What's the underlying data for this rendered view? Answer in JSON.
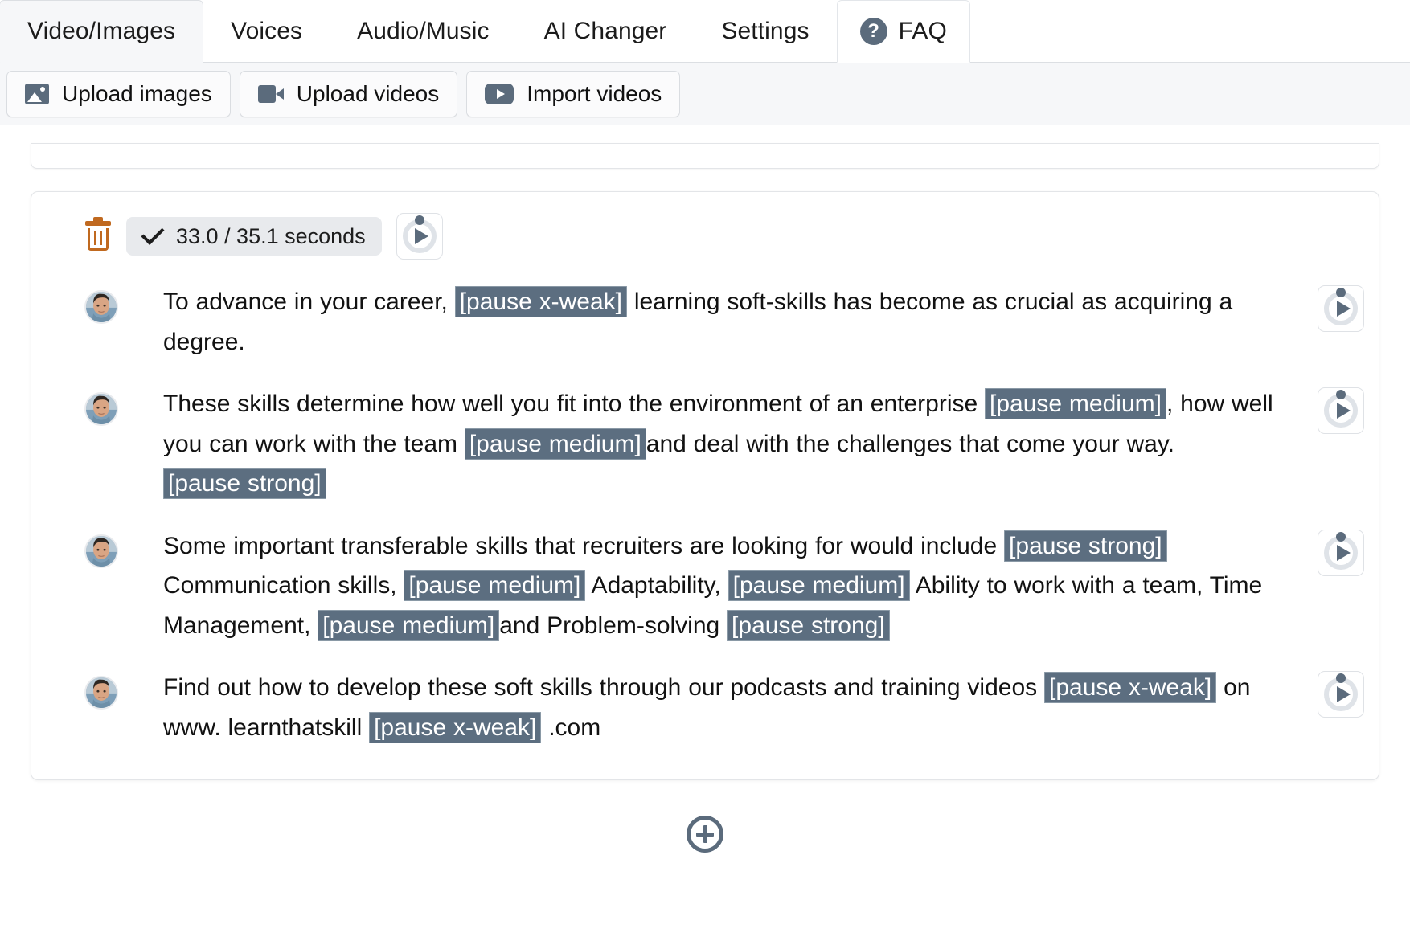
{
  "tabs": [
    {
      "label": "Video/Images",
      "active": true
    },
    {
      "label": "Voices",
      "active": false
    },
    {
      "label": "Audio/Music",
      "active": false
    },
    {
      "label": "AI Changer",
      "active": false
    },
    {
      "label": "Settings",
      "active": false
    },
    {
      "label": "FAQ",
      "active": false,
      "icon": "question-circle-icon"
    }
  ],
  "toolbar": {
    "upload_images": "Upload images",
    "upload_videos": "Upload videos",
    "import_videos": "Import videos",
    "icons": {
      "upload_images": "image-icon",
      "upload_videos": "video-camera-icon",
      "import_videos": "youtube-play-icon"
    }
  },
  "block": {
    "delete_icon": "trash-icon",
    "duration_label": "33.0 / 35.1 seconds",
    "duration_check_icon": "check-icon",
    "play_icon": "play-circle-icon",
    "current_seconds": "33.0",
    "total_seconds": "35.1"
  },
  "colors": {
    "tag_background": "#5c6e80",
    "tag_text": "#ffffff",
    "accent_slate": "#5b6b7c",
    "trash_orange": "#c0691f",
    "toolbar_background": "#f6f7f9",
    "pill_background": "#e8eaed"
  },
  "sentences": [
    {
      "avatar": "speaker-avatar",
      "play_icon": "play-circle-icon",
      "parts": [
        {
          "t": "text",
          "v": "To advance in your career, "
        },
        {
          "t": "tag",
          "v": "[pause x-weak]"
        },
        {
          "t": "text",
          "v": " learning soft-skills has become as crucial as acquiring a degree."
        }
      ]
    },
    {
      "avatar": "speaker-avatar",
      "play_icon": "play-circle-icon",
      "parts": [
        {
          "t": "text",
          "v": "These skills determine how well you fit into the environment of an enterprise "
        },
        {
          "t": "tag",
          "v": "[pause medium]"
        },
        {
          "t": "text",
          "v": ", how well you can work with the team "
        },
        {
          "t": "tag",
          "v": "[pause medium]"
        },
        {
          "t": "text",
          "v": "and deal with the challenges that come your way. "
        },
        {
          "t": "tag",
          "v": "[pause strong]"
        }
      ]
    },
    {
      "avatar": "speaker-avatar",
      "play_icon": "play-circle-icon",
      "parts": [
        {
          "t": "text",
          "v": "Some important transferable skills that recruiters are looking for would include "
        },
        {
          "t": "tag",
          "v": "[pause strong]"
        },
        {
          "t": "text",
          "v": " Communication skills, "
        },
        {
          "t": "tag",
          "v": "[pause medium]"
        },
        {
          "t": "text",
          "v": " Adaptability, "
        },
        {
          "t": "tag",
          "v": "[pause medium]"
        },
        {
          "t": "text",
          "v": " Ability to work with a team, Time Management, "
        },
        {
          "t": "tag",
          "v": "[pause medium]"
        },
        {
          "t": "text",
          "v": "and Problem-solving "
        },
        {
          "t": "tag",
          "v": "[pause strong]"
        }
      ]
    },
    {
      "avatar": "speaker-avatar",
      "play_icon": "play-circle-icon",
      "parts": [
        {
          "t": "text",
          "v": "Find out how to develop these soft skills through our podcasts and training videos "
        },
        {
          "t": "tag",
          "v": "[pause x-weak]"
        },
        {
          "t": "text",
          "v": " on www. learnthatskill "
        },
        {
          "t": "tag",
          "v": "[pause x-weak]"
        },
        {
          "t": "text",
          "v": " .com"
        }
      ]
    }
  ],
  "add_block": {
    "icon": "plus-circle-icon"
  }
}
